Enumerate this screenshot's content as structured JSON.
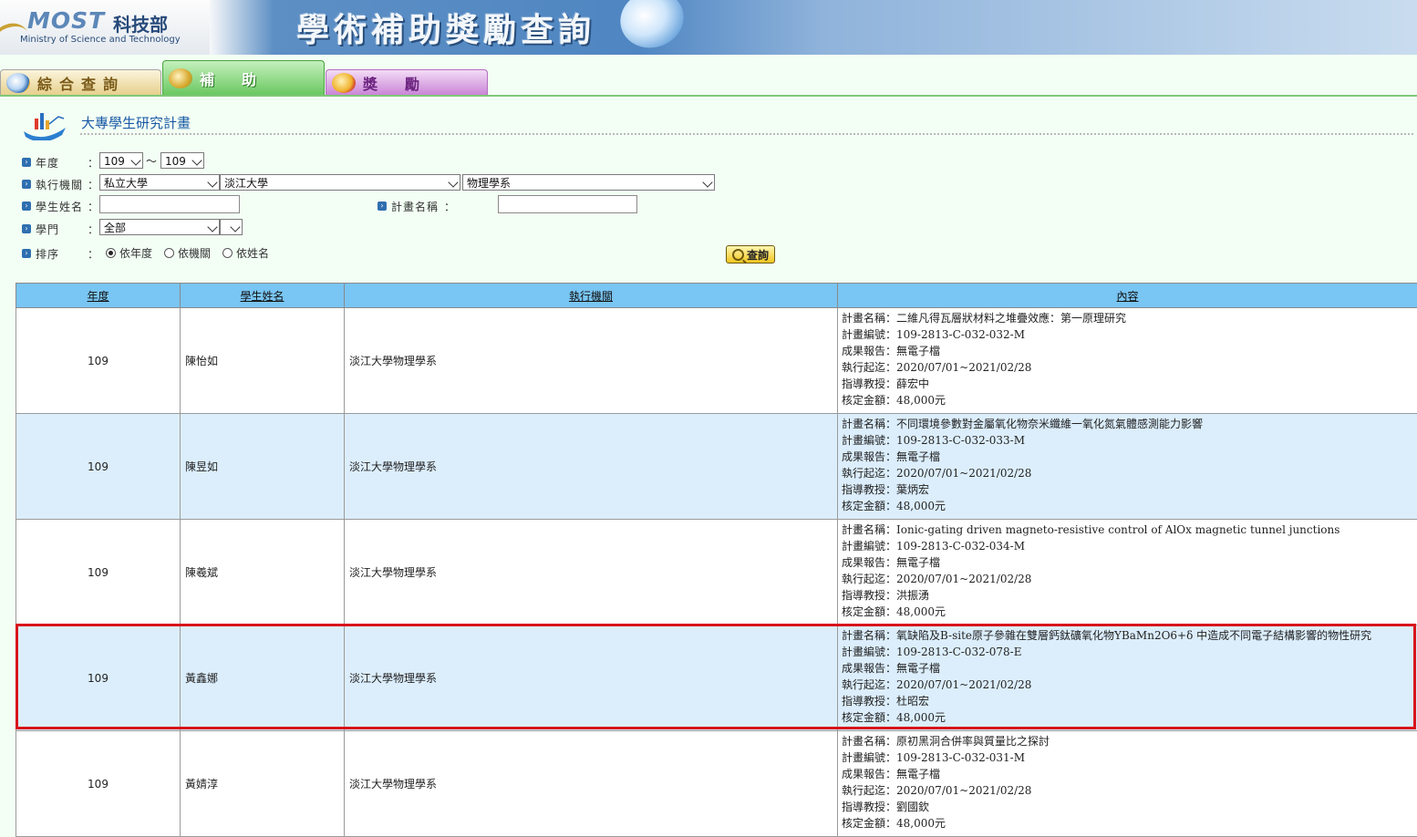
{
  "banner": {
    "logo_most": "MOST",
    "logo_cn": "科技部",
    "logo_en": "Ministry of Science and Technology",
    "title": "學術補助獎勵查詢"
  },
  "tabs": [
    {
      "label": "綜合查詢",
      "icon": "magnifier-globe-icon",
      "active": false,
      "color": "#e6cf8a"
    },
    {
      "label": "補助",
      "icon": "money-stack-icon",
      "active": true,
      "color": "#68c75e"
    },
    {
      "label": "獎勵",
      "icon": "medal-icon",
      "active": false,
      "color": "#c982d6"
    }
  ],
  "section": {
    "title": "大專學生研究計畫",
    "icon": "research-chart-icon"
  },
  "form": {
    "year_label": "年度",
    "year_from": "109",
    "year_sep": "～",
    "year_to": "109",
    "org_label": "執行機關",
    "org_type": "私立大學",
    "org_school": "淡江大學",
    "org_dept": "物理學系",
    "student_label": "學生姓名",
    "student_value": "",
    "plan_label": "計畫名稱",
    "plan_value": "",
    "field_label": "學門",
    "field_value": "全部",
    "field_sub": "",
    "sort_label": "排序",
    "sort_options": [
      "依年度",
      "依機關",
      "依姓名"
    ],
    "sort_selected": "依年度",
    "colon": "：",
    "query_button": "查詢"
  },
  "table": {
    "headers": [
      "年度",
      "學生姓名",
      "執行機關",
      "內容"
    ],
    "content_keys": {
      "plan_name": "計畫名稱：",
      "plan_no": "計畫編號：",
      "report": "成果報告：",
      "period": "執行起迄：",
      "advisor": "指導教授：",
      "amount": "核定金額："
    },
    "rows": [
      {
        "year": "109",
        "student": "陳怡如",
        "org": "淡江大學物理學系",
        "plan_name": "二維凡得瓦層狀材料之堆疊效應：第一原理研究",
        "plan_no": "109-2813-C-032-032-M",
        "report": "無電子檔",
        "period": "2020/07/01~2021/02/28",
        "advisor": "薛宏中",
        "amount": "48,000元"
      },
      {
        "year": "109",
        "student": "陳昱如",
        "org": "淡江大學物理學系",
        "plan_name": "不同環境參數對金屬氧化物奈米纖維一氧化氮氣體感測能力影響",
        "plan_no": "109-2813-C-032-033-M",
        "report": "無電子檔",
        "period": "2020/07/01~2021/02/28",
        "advisor": "葉炳宏",
        "amount": "48,000元"
      },
      {
        "year": "109",
        "student": "陳羲斌",
        "org": "淡江大學物理學系",
        "plan_name": "Ionic-gating driven magneto-resistive control of AlOx magnetic tunnel junctions",
        "plan_no": "109-2813-C-032-034-M",
        "report": "無電子檔",
        "period": "2020/07/01~2021/02/28",
        "advisor": "洪振湧",
        "amount": "48,000元"
      },
      {
        "year": "109",
        "student": "黃鑫娜",
        "org": "淡江大學物理學系",
        "plan_name": "氧缺陷及B-site原子參雜在雙層鈣鈦礦氧化物YBaMn2O6+δ 中造成不同電子結構影響的物性研究",
        "plan_no": "109-2813-C-032-078-E",
        "report": "無電子檔",
        "period": "2020/07/01~2021/02/28",
        "advisor": "杜昭宏",
        "amount": "48,000元"
      },
      {
        "year": "109",
        "student": "黃婧淳",
        "org": "淡江大學物理學系",
        "plan_name": "原初黑洞合併率與質量比之探討",
        "plan_no": "109-2813-C-032-031-M",
        "report": "無電子檔",
        "period": "2020/07/01~2021/02/28",
        "advisor": "劉國欽",
        "amount": "48,000元"
      }
    ],
    "highlighted_row": 3,
    "highlight_color": "#d8141c"
  }
}
